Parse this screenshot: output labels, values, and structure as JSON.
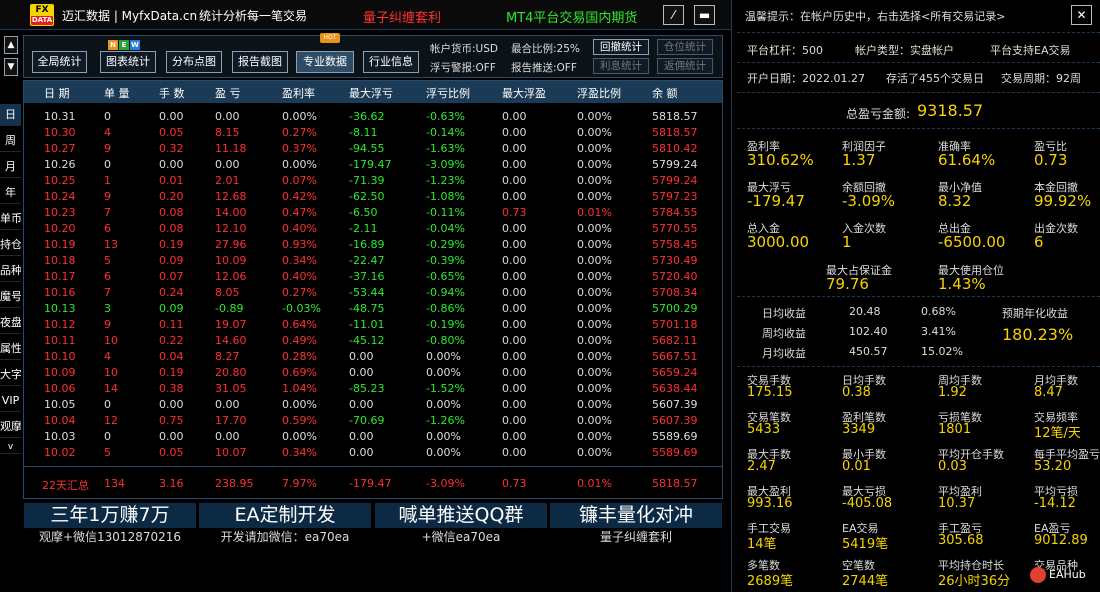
{
  "title": {
    "logo_top": "FX",
    "logo_bottom": "DATA",
    "app": "迈汇数据 | MyfxData.cn",
    "slogan": "统计分析每一笔交易",
    "strategy": "量子纠缠套利",
    "platform": "MT4平台交易国内期货",
    "pen_btn": "⁄",
    "min_btn": "▬"
  },
  "toolbar": {
    "buttons": [
      "全局统计",
      "图表统计",
      "分布点图",
      "报告截图",
      "专业数据",
      "行业信息"
    ],
    "new_badge": [
      "N",
      "E",
      "W"
    ],
    "hot_badge": "HOT",
    "currency": "帐户货币:USD",
    "margin_ratio": "最合比例:25%",
    "float_warn": "浮亏警报:OFF",
    "report_push": "报告推送:OFF",
    "btn_retrace": "回撤统计",
    "btn_position": "仓位统计",
    "btn_interest": "利息统计",
    "btn_rebate": "返佣统计"
  },
  "leftnav": {
    "up": "▲",
    "down": "▼",
    "items": [
      "日",
      "周",
      "月",
      "年",
      "单币",
      "持仓",
      "品种",
      "魔号",
      "夜盘",
      "属性",
      "大字",
      "VIP",
      "观摩"
    ],
    "more": "v"
  },
  "table": {
    "headers": [
      "日 期",
      "单 量",
      "手 数",
      "盈 亏",
      "盈利率",
      "最大浮亏",
      "浮亏比例",
      "最大浮盈",
      "浮盈比例",
      "余 额"
    ],
    "rows": [
      [
        "10.31",
        "0",
        "0.00",
        "0.00",
        "0.00%",
        "-36.62",
        "-0.63%",
        "0.00",
        "0.00%",
        "5818.57"
      ],
      [
        "10.30",
        "4",
        "0.05",
        "8.15",
        "0.27%",
        "-8.11",
        "-0.14%",
        "0.00",
        "0.00%",
        "5818.57"
      ],
      [
        "10.27",
        "9",
        "0.32",
        "11.18",
        "0.37%",
        "-94.55",
        "-1.63%",
        "0.00",
        "0.00%",
        "5810.42"
      ],
      [
        "10.26",
        "0",
        "0.00",
        "0.00",
        "0.00%",
        "-179.47",
        "-3.09%",
        "0.00",
        "0.00%",
        "5799.24"
      ],
      [
        "10.25",
        "1",
        "0.01",
        "2.01",
        "0.07%",
        "-71.39",
        "-1.23%",
        "0.00",
        "0.00%",
        "5799.24"
      ],
      [
        "10.24",
        "9",
        "0.20",
        "12.68",
        "0.42%",
        "-62.50",
        "-1.08%",
        "0.00",
        "0.00%",
        "5797.23"
      ],
      [
        "10.23",
        "7",
        "0.08",
        "14.00",
        "0.47%",
        "-6.50",
        "-0.11%",
        "0.73",
        "0.01%",
        "5784.55"
      ],
      [
        "10.20",
        "6",
        "0.08",
        "12.10",
        "0.40%",
        "-2.11",
        "-0.04%",
        "0.00",
        "0.00%",
        "5770.55"
      ],
      [
        "10.19",
        "13",
        "0.19",
        "27.96",
        "0.93%",
        "-16.89",
        "-0.29%",
        "0.00",
        "0.00%",
        "5758.45"
      ],
      [
        "10.18",
        "5",
        "0.09",
        "10.09",
        "0.34%",
        "-22.47",
        "-0.39%",
        "0.00",
        "0.00%",
        "5730.49"
      ],
      [
        "10.17",
        "6",
        "0.07",
        "12.06",
        "0.40%",
        "-37.16",
        "-0.65%",
        "0.00",
        "0.00%",
        "5720.40"
      ],
      [
        "10.16",
        "7",
        "0.24",
        "8.05",
        "0.27%",
        "-53.44",
        "-0.94%",
        "0.00",
        "0.00%",
        "5708.34"
      ],
      [
        "10.13",
        "3",
        "0.09",
        "-0.89",
        "-0.03%",
        "-48.75",
        "-0.86%",
        "0.00",
        "0.00%",
        "5700.29"
      ],
      [
        "10.12",
        "9",
        "0.11",
        "19.07",
        "0.64%",
        "-11.01",
        "-0.19%",
        "0.00",
        "0.00%",
        "5701.18"
      ],
      [
        "10.11",
        "10",
        "0.22",
        "14.60",
        "0.49%",
        "-45.12",
        "-0.80%",
        "0.00",
        "0.00%",
        "5682.11"
      ],
      [
        "10.10",
        "4",
        "0.04",
        "8.27",
        "0.28%",
        "0.00",
        "0.00%",
        "0.00",
        "0.00%",
        "5667.51"
      ],
      [
        "10.09",
        "10",
        "0.19",
        "20.80",
        "0.69%",
        "0.00",
        "0.00%",
        "0.00",
        "0.00%",
        "5659.24"
      ],
      [
        "10.06",
        "14",
        "0.38",
        "31.05",
        "1.04%",
        "-85.23",
        "-1.52%",
        "0.00",
        "0.00%",
        "5638.44"
      ],
      [
        "10.05",
        "0",
        "0.00",
        "0.00",
        "0.00%",
        "0.00",
        "0.00%",
        "0.00",
        "0.00%",
        "5607.39"
      ],
      [
        "10.04",
        "12",
        "0.75",
        "17.70",
        "0.59%",
        "-70.69",
        "-1.26%",
        "0.00",
        "0.00%",
        "5607.39"
      ],
      [
        "10.03",
        "0",
        "0.00",
        "0.00",
        "0.00%",
        "0.00",
        "0.00%",
        "0.00",
        "0.00%",
        "5589.69"
      ],
      [
        "10.02",
        "5",
        "0.05",
        "10.07",
        "0.34%",
        "0.00",
        "0.00%",
        "0.00",
        "0.00%",
        "5589.69"
      ]
    ],
    "row_colors": [
      "white",
      "red",
      "red",
      "white",
      "red",
      "red",
      "red",
      "red",
      "red",
      "red",
      "red",
      "red",
      "green",
      "red",
      "red",
      "red",
      "red",
      "red",
      "white",
      "red",
      "white",
      "red"
    ],
    "summary": [
      "22天汇总",
      "134",
      "3.16",
      "238.95",
      "7.97%",
      "-179.47",
      "-3.09%",
      "0.73",
      "0.01%",
      "5818.57"
    ]
  },
  "banners": [
    {
      "big": "三年1万赚7万",
      "small": "观摩+微信13012870216"
    },
    {
      "big": "EA定制开发",
      "small": "开发请加微信：ea70ea"
    },
    {
      "big": "喊单推送QQ群",
      "small": "+微信ea70ea"
    },
    {
      "big": "镰丰量化对冲",
      "small": "量子纠缠套利"
    }
  ],
  "right": {
    "tip": "温馨提示：在帐户历史中，右击选择<所有交易记录>",
    "close": "✕",
    "leverage": "平台杠杆：500",
    "acct_type": "帐户类型：实盘帐户",
    "ea_support": "平台支持EA交易",
    "open_date": "开户日期：2022.01.27",
    "records": "存活了455个交易日",
    "cycle": "交易周期：92周",
    "total_label": "总盈亏金额:",
    "total_value": "9318.57",
    "stats1": [
      {
        "l": "盈利率",
        "v": "310.62%"
      },
      {
        "l": "利润因子",
        "v": "1.37"
      },
      {
        "l": "准确率",
        "v": "61.64%"
      },
      {
        "l": "盈亏比",
        "v": "0.73"
      },
      {
        "l": "最大浮亏",
        "v": "-179.47"
      },
      {
        "l": "余额回撤",
        "v": "-3.09%"
      },
      {
        "l": "最小净值",
        "v": "8.32"
      },
      {
        "l": "本金回撤",
        "v": "99.92%"
      },
      {
        "l": "总入金",
        "v": "3000.00"
      },
      {
        "l": "入金次数",
        "v": "1"
      },
      {
        "l": "总出金",
        "v": "-6500.00"
      },
      {
        "l": "出金次数",
        "v": "6"
      }
    ],
    "max_margin_label": "最大占保证金",
    "max_margin_value": "79.76",
    "max_pos_label": "最大使用仓位",
    "max_pos_value": "1.43%",
    "income": [
      {
        "l": "日均收益",
        "a": "20.48",
        "p": "0.68%"
      },
      {
        "l": "周均收益",
        "a": "102.40",
        "p": "3.41%"
      },
      {
        "l": "月均收益",
        "a": "450.57",
        "p": "15.02%"
      }
    ],
    "annual_label": "预期年化收益",
    "annual_value": "180.23%",
    "stats2": [
      {
        "l": "交易手数",
        "v": "175.15"
      },
      {
        "l": "日均手数",
        "v": "0.38"
      },
      {
        "l": "周均手数",
        "v": "1.92"
      },
      {
        "l": "月均手数",
        "v": "8.47"
      },
      {
        "l": "交易笔数",
        "v": "5433"
      },
      {
        "l": "盈利笔数",
        "v": "3349"
      },
      {
        "l": "亏损笔数",
        "v": "1801"
      },
      {
        "l": "交易频率",
        "v": "12笔/天"
      },
      {
        "l": "最大手数",
        "v": "2.47"
      },
      {
        "l": "最小手数",
        "v": "0.01"
      },
      {
        "l": "平均开仓手数",
        "v": "0.03"
      },
      {
        "l": "每手平均盈亏",
        "v": "53.20"
      },
      {
        "l": "最大盈利",
        "v": "993.16"
      },
      {
        "l": "最大亏损",
        "v": "-405.08"
      },
      {
        "l": "平均盈利",
        "v": "10.37"
      },
      {
        "l": "平均亏损",
        "v": "-14.12"
      },
      {
        "l": "手工交易",
        "v": "14笔"
      },
      {
        "l": "EA交易",
        "v": "5419笔"
      },
      {
        "l": "手工盈亏",
        "v": "305.68"
      },
      {
        "l": "EA盈亏",
        "v": "9012.89"
      },
      {
        "l": "多笔数",
        "v": "2689笔"
      },
      {
        "l": "空笔数",
        "v": "2744笔"
      },
      {
        "l": "平均持仓时长",
        "v": "26小时36分"
      },
      {
        "l": "交易品种",
        "v": ""
      }
    ],
    "watermark": "EAHub"
  },
  "colors": {
    "red": "#ff3030",
    "green": "#2ee82e",
    "white": "#dddddd",
    "yellow": "#f5d400",
    "panel": "#1b3a55"
  }
}
